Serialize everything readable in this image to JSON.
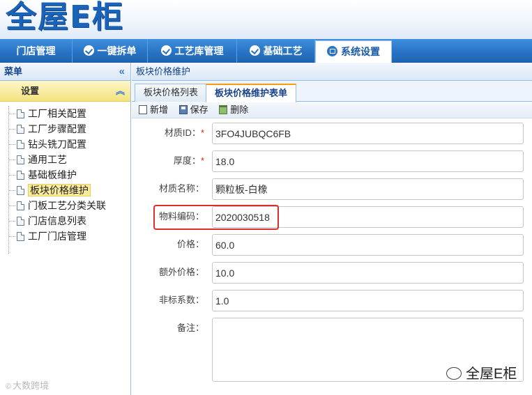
{
  "header": {
    "logo_text": "全屋E柜"
  },
  "nav": {
    "items": [
      {
        "label": "门店管理",
        "icon": "none"
      },
      {
        "label": "一键拆单",
        "icon": "check-circle-icon"
      },
      {
        "label": "工艺库管理",
        "icon": "check-circle-icon"
      },
      {
        "label": "基础工艺",
        "icon": "check-circle-icon"
      },
      {
        "label": "系统设置",
        "icon": "monitor-icon"
      }
    ],
    "active": "系统设置"
  },
  "sidebar": {
    "title": "菜单",
    "collapse_icon": "«",
    "group": {
      "label": "设置",
      "toggle_icon": "︽"
    },
    "items": [
      {
        "label": "工厂相关配置"
      },
      {
        "label": "工厂步骤配置"
      },
      {
        "label": "钻头铣刀配置"
      },
      {
        "label": "通用工艺"
      },
      {
        "label": "基础板维护"
      },
      {
        "label": "板块价格维护"
      },
      {
        "label": "门板工艺分类关联"
      },
      {
        "label": "门店信息列表"
      },
      {
        "label": "工厂门店管理"
      }
    ],
    "selected": "板块价格维护"
  },
  "main": {
    "breadcrumb": "板块价格维护",
    "tabs": [
      {
        "label": "板块价格列表"
      },
      {
        "label": "板块价格维护表单"
      }
    ],
    "active_tab": "板块价格维护表单",
    "toolbar": {
      "new_label": "新增",
      "save_label": "保存",
      "delete_label": "删除"
    },
    "form": {
      "material_id": {
        "label": "材质ID：",
        "required_mark": "*",
        "value": "3FO4JUBQC6FB"
      },
      "thickness": {
        "label": "厚度：",
        "required_mark": "*",
        "value": "18.0"
      },
      "material_name": {
        "label": "材质名称：",
        "value": "颗粒板-白橡"
      },
      "material_code": {
        "label": "物料编码：",
        "value": "2020030518"
      },
      "price": {
        "label": "价格：",
        "value": "60.0"
      },
      "extra_price": {
        "label": "额外价格：",
        "value": "10.0"
      },
      "nonstandard_factor": {
        "label": "非标系数：",
        "value": "1.0"
      },
      "remark": {
        "label": "备注：",
        "value": ""
      }
    }
  },
  "watermarks": {
    "left": "大数跨境",
    "right": "全屋E柜"
  },
  "colors": {
    "nav_blue": "#2a74c5",
    "highlight_red": "#e02b2b",
    "accent_orange": "#f39c12",
    "group_yellow": "#f3e27e"
  }
}
